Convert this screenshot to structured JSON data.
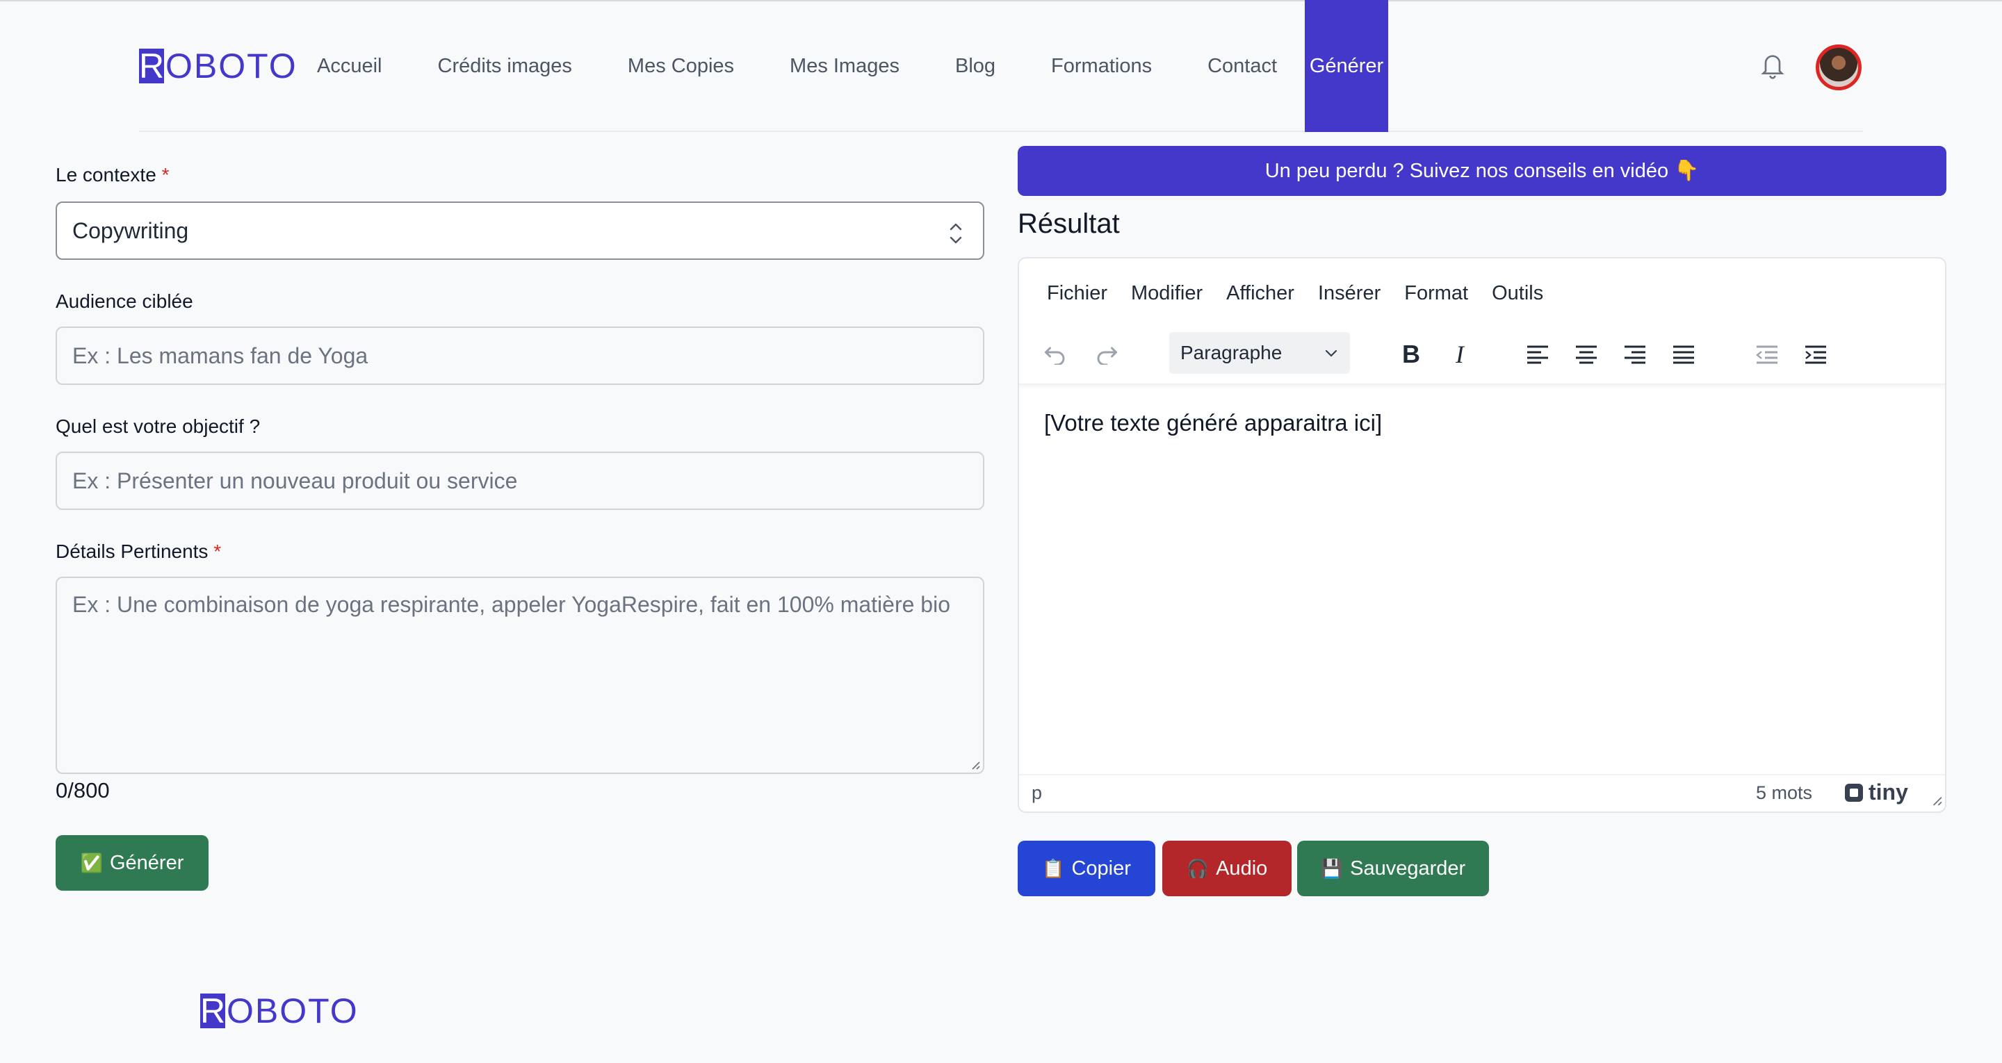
{
  "brand": {
    "logo_first": "R",
    "logo_rest": "OBOTO"
  },
  "nav": {
    "links": [
      "Accueil",
      "Crédits images",
      "Mes Copies",
      "Mes Images",
      "Blog",
      "Formations",
      "Contact",
      "Générer"
    ],
    "active": "Générer"
  },
  "form": {
    "context_label": "Le contexte",
    "required_mark": "*",
    "context_value": "Copywriting",
    "audience_label": "Audience ciblée",
    "audience_placeholder": "Ex : Les mamans fan de Yoga",
    "objective_label": "Quel est votre objectif ?",
    "objective_placeholder": "Ex : Présenter un nouveau produit ou service",
    "details_label": "Détails Pertinents",
    "details_placeholder": "Ex : Une combinaison de yoga respirante, appeler YogaRespire, fait en 100% matière bio",
    "counter": "0/800",
    "generate_emoji": "✅",
    "generate_label": "Générer"
  },
  "result": {
    "banner": "Un peu perdu ? Suivez nos conseils en vidéo 👇",
    "title": "Résultat",
    "menu": [
      "Fichier",
      "Modifier",
      "Afficher",
      "Insérer",
      "Format",
      "Outils"
    ],
    "block_format": "Paragraphe",
    "content": "[Votre texte généré apparaitra ici]",
    "status_path": "p",
    "word_count": "5 mots",
    "tiny_brand": "tiny"
  },
  "actions": {
    "copy_emoji": "📋",
    "copy_label": "Copier",
    "audio_emoji": "🎧",
    "audio_label": "Audio",
    "save_emoji": "💾",
    "save_label": "Sauvegarder"
  },
  "colors": {
    "brand": "#4338ca",
    "green": "#2f7a52",
    "blue": "#2545d4",
    "red": "#b3262a",
    "required": "#dc2626"
  }
}
